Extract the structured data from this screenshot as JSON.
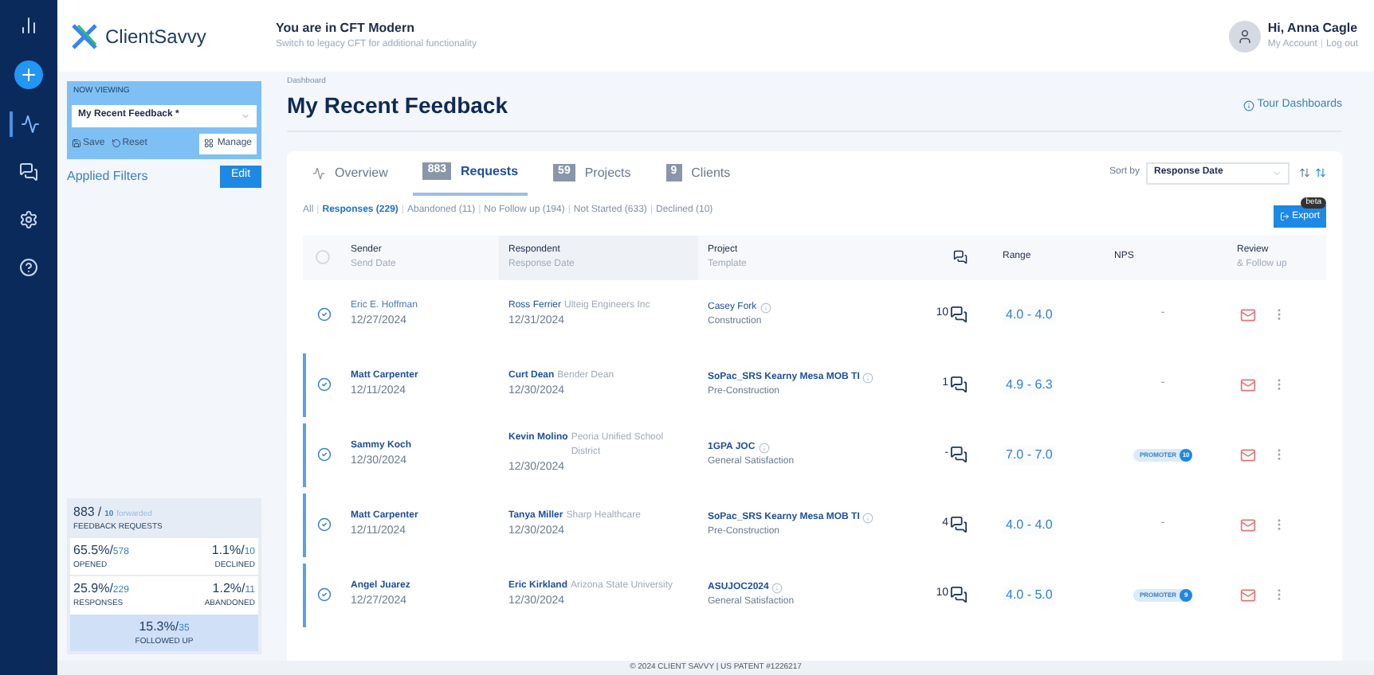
{
  "brand": {
    "name": "ClientSavvy"
  },
  "header": {
    "mode": "You are in CFT Modern",
    "switch_link": "Switch to legacy CFT for additional functionality",
    "greeting": "Hi, Anna Cagle",
    "account_link": "My Account",
    "logout_link": "Log out"
  },
  "header_separator": "|",
  "rail": [
    {
      "selected": false
    },
    {
      "selected": false
    },
    {
      "selected": true
    },
    {
      "selected": false
    },
    {
      "selected": false
    },
    {
      "selected": false
    }
  ],
  "sidebar": {
    "now_viewing_label": "NOW VIEWING",
    "view": "My Recent Feedback *",
    "save": "Save",
    "reset": "Reset",
    "manage": "Manage",
    "filters": "Applied Filters",
    "edit": "Edit",
    "stats": {
      "slash": "/",
      "total": "883",
      "forwarded_count": "10",
      "forwarded_label": "forwarded",
      "total_label": "FEEDBACK REQUESTS",
      "cells": [
        {
          "pct": "65.5%",
          "count": "578",
          "label": "OPENED"
        },
        {
          "pct": "1.1%",
          "count": "10",
          "label": "DECLINED"
        },
        {
          "pct": "25.9%",
          "count": "229",
          "label": "RESPONSES"
        },
        {
          "pct": "1.2%",
          "count": "11",
          "label": "ABANDONED"
        }
      ],
      "followed": {
        "pct": "15.3%",
        "count": "35",
        "label": "FOLLOWED UP"
      }
    }
  },
  "breadcrumb": "Dashboard",
  "title": "My Recent Feedback",
  "tour": "Tour Dashboards",
  "tabs": [
    {
      "label": "Overview",
      "selected": false
    },
    {
      "label": "Requests",
      "count": "883",
      "selected": true
    },
    {
      "label": "Projects",
      "count": "59",
      "selected": false
    },
    {
      "label": "Clients",
      "count": "9",
      "selected": false
    }
  ],
  "sort": {
    "label": "Sort by",
    "value": "Response Date"
  },
  "filter_separator": "|",
  "select_all": {
    "checked": false
  },
  "filters": [
    {
      "label": "All",
      "selected": false
    },
    {
      "label": "Responses (229)",
      "selected": true
    },
    {
      "label": "Abandoned (11)",
      "selected": false
    },
    {
      "label": "No Follow up (194)",
      "selected": false
    },
    {
      "label": "Not Started (633)",
      "selected": false
    },
    {
      "label": "Declined (10)",
      "selected": false
    }
  ],
  "export": {
    "label": "Export",
    "badge": "beta"
  },
  "columns": [
    {
      "title": "Sender",
      "sub": "Send Date"
    },
    {
      "title": "Respondent",
      "sub": "Response Date"
    },
    {
      "title": "Project",
      "sub": "Template"
    },
    {
      "title": "Range"
    },
    {
      "title": "NPS"
    },
    {
      "title": "Review",
      "sub": "& Follow up"
    }
  ],
  "rows": [
    {
      "unread": false,
      "sender": "Eric E. Hoffman",
      "send_date": "12/27/2024",
      "respondent": "Ross Ferrier",
      "company": "Ulteig Engineers Inc",
      "response_date": "12/31/2024",
      "project": "Casey Fork",
      "template": "Construction",
      "comments": "10",
      "range": "4.0 - 4.0",
      "nps": {
        "kind": "none",
        "text": "-"
      }
    },
    {
      "unread": true,
      "sender": "Matt Carpenter",
      "send_date": "12/11/2024",
      "respondent": "Curt Dean",
      "company": "Bender Dean",
      "response_date": "12/30/2024",
      "project": "SoPac_SRS Kearny Mesa MOB TI",
      "template": "Pre-Construction",
      "comments": "1",
      "range": "4.9 - 6.3",
      "nps": {
        "kind": "none",
        "text": "-"
      }
    },
    {
      "unread": true,
      "sender": "Sammy Koch",
      "send_date": "12/30/2024",
      "respondent": "Kevin Molino",
      "company": "Peoria Unified School District",
      "response_date": "12/30/2024",
      "project": "1GPA JOC",
      "template": "General Satisfaction",
      "comments": "-",
      "range": "7.0 - 7.0",
      "nps": {
        "kind": "badge",
        "text": "PROMOTER",
        "score": "10"
      }
    },
    {
      "unread": true,
      "sender": "Matt Carpenter",
      "send_date": "12/11/2024",
      "respondent": "Tanya Miller",
      "company": "Sharp Healthcare",
      "response_date": "12/30/2024",
      "project": "SoPac_SRS Kearny Mesa MOB TI",
      "template": "Pre-Construction",
      "comments": "4",
      "range": "4.0 - 4.0",
      "nps": {
        "kind": "none",
        "text": "-"
      }
    },
    {
      "unread": true,
      "sender": "Angel Juarez",
      "send_date": "12/27/2024",
      "respondent": "Eric Kirkland",
      "company": "Arizona State University",
      "response_date": "12/30/2024",
      "project": "ASUJOC2024",
      "template": "General Satisfaction",
      "comments": "10",
      "range": "4.0 - 5.0",
      "nps": {
        "kind": "badge",
        "text": "PROMOTER",
        "score": "9"
      }
    }
  ],
  "footer": "© 2024 CLIENT SAVVY | US PATENT #1226217"
}
